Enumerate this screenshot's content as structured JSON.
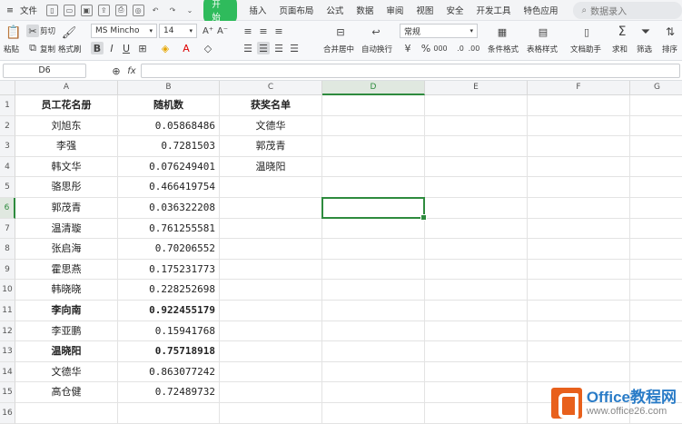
{
  "menubar": {
    "file_label": "文件",
    "start_tab": "开始",
    "tabs": [
      "插入",
      "页面布局",
      "公式",
      "数据",
      "审阅",
      "视图",
      "安全",
      "开发工具",
      "特色应用"
    ],
    "search_placeholder": "数据录入"
  },
  "ribbon": {
    "paste": "粘贴",
    "cut": "剪切",
    "copy": "复制",
    "format_painter": "格式刷",
    "font_name": "MS Mincho",
    "font_size": "14",
    "bold": "B",
    "italic": "I",
    "underline": "U",
    "merge_center": "合并居中",
    "wrap": "自动换行",
    "number_format": "常规",
    "percent": "%",
    "thousands": "000",
    "cond_format": "条件格式",
    "table_style": "表格样式",
    "doc_helper": "文档助手",
    "sum": "求和",
    "filter": "筛选",
    "sort": "排序"
  },
  "formula_bar": {
    "cell_ref": "D6",
    "fx": "fx",
    "content": ""
  },
  "columns": [
    "A",
    "B",
    "C",
    "D",
    "E",
    "F",
    "G"
  ],
  "rows": [
    "1",
    "2",
    "3",
    "4",
    "5",
    "6",
    "7",
    "8",
    "9",
    "10",
    "11",
    "12",
    "13",
    "14",
    "15",
    "16"
  ],
  "active_cell": {
    "col": "D",
    "row": "6"
  },
  "sheet": {
    "A": [
      "员工花名册",
      "刘旭东",
      "李强",
      "韩文华",
      "骆思彤",
      "郭茂青",
      "温清璇",
      "张启海",
      "霍思燕",
      "韩晓晓",
      "李向南",
      "李亚鹏",
      "温晓阳",
      "文德华",
      "高仓健",
      ""
    ],
    "B": [
      "随机数",
      "0.05868486",
      "0.7281503",
      "0.076249401",
      "0.466419754",
      "0.036322208",
      "0.761255581",
      "0.70206552",
      "0.175231773",
      "0.228252698",
      "0.922455179",
      "0.15941768",
      "0.75718918",
      "0.863077242",
      "0.72489732",
      ""
    ],
    "C": [
      "获奖名单",
      "文德华",
      "郭茂青",
      "温晓阳",
      "",
      "",
      "",
      "",
      "",
      "",
      "",
      "",
      "",
      "",
      "",
      ""
    ]
  },
  "bold_rows": [
    10,
    12
  ],
  "watermark": {
    "line1": "Office教程网",
    "line2": "www.office26.com"
  }
}
